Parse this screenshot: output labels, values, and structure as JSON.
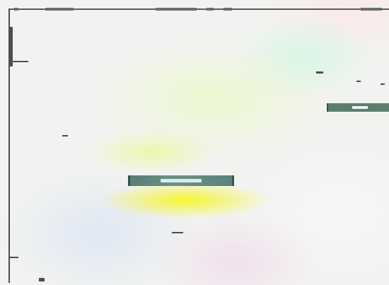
{
  "window": {
    "frame_color": "#4a4f4a"
  },
  "desktop": {
    "highlight_colors": [
      "#f6f628",
      "#ebf896",
      "#d6f6e4",
      "#dee6f5",
      "#f2deec"
    ]
  },
  "toolbar_handle": {
    "color": "#5b7e70"
  },
  "dialog": {
    "title_bar_color": "#5a7d76",
    "title_label_unreadable": true
  }
}
